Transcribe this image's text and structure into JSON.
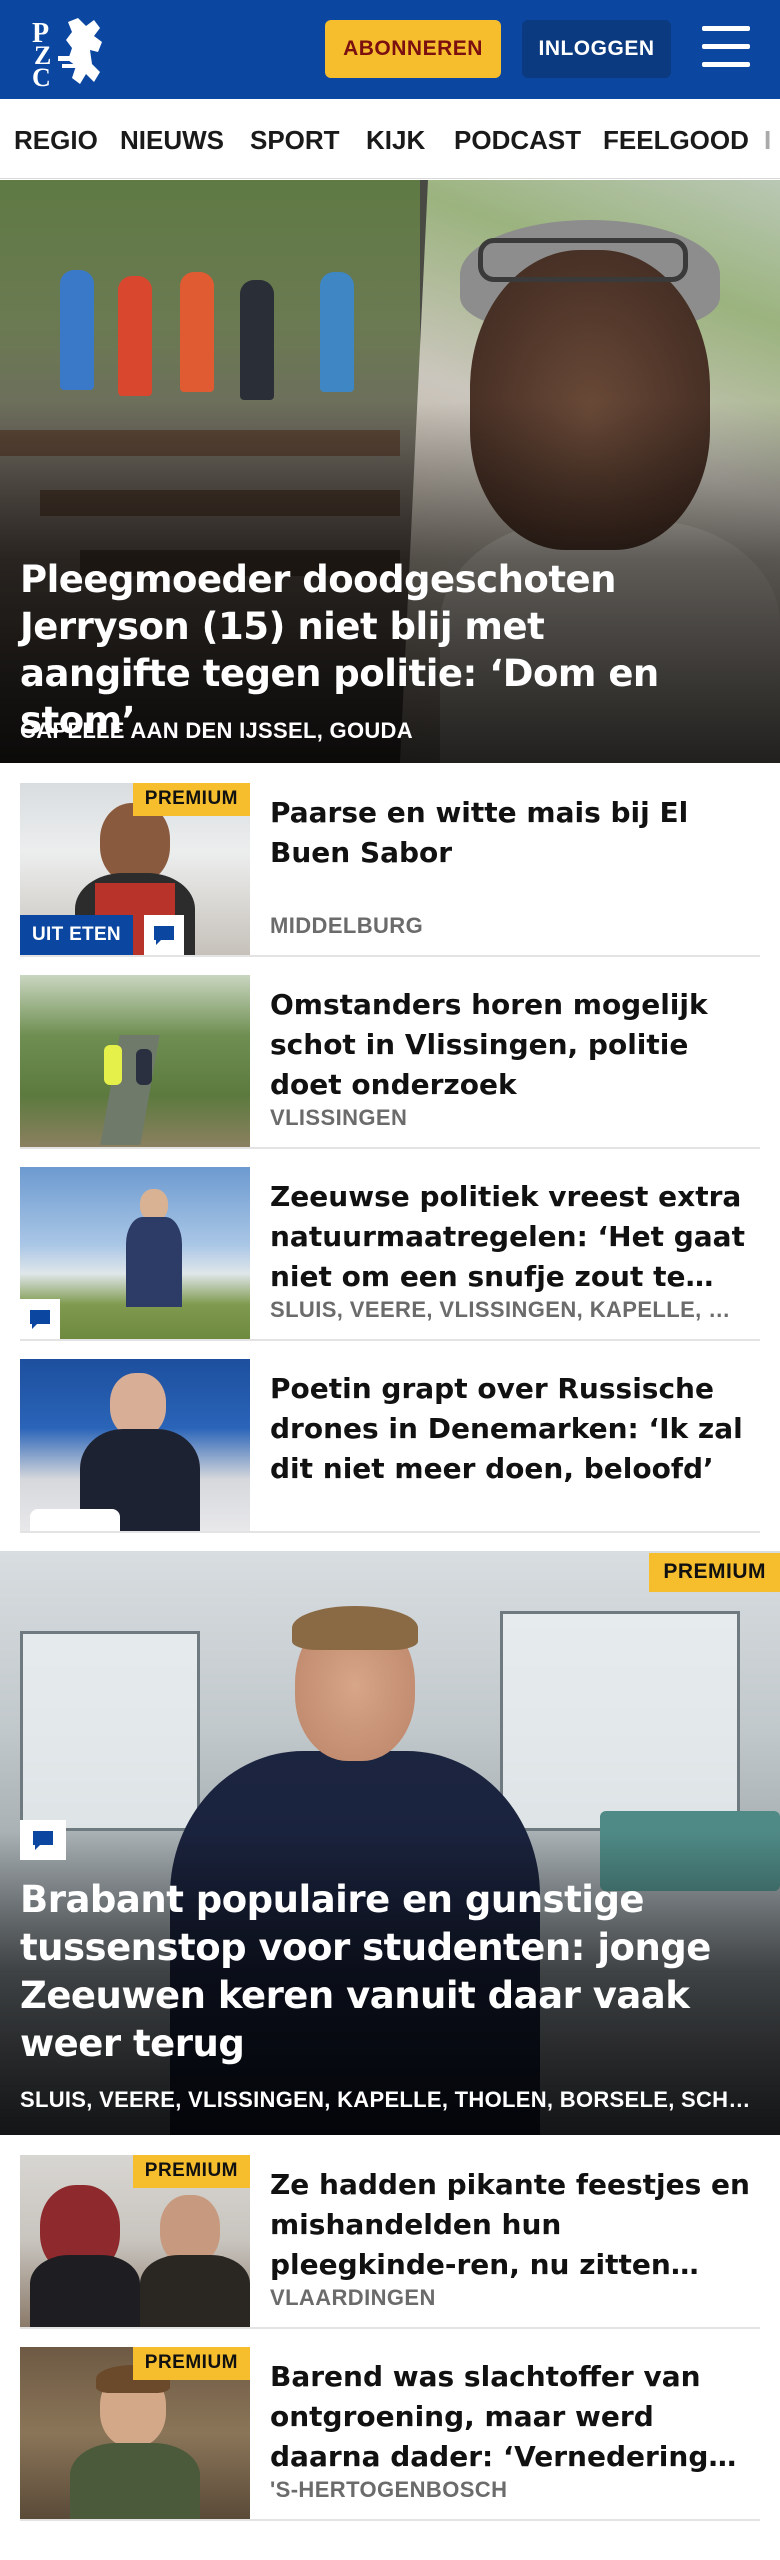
{
  "header": {
    "logo_text": "PZC",
    "subscribe_label": "ABONNEREN",
    "login_label": "INLOGGEN",
    "brand_color": "#0b47a1",
    "accent_color": "#f6be2c"
  },
  "nav": {
    "items": [
      {
        "label": "REGIO"
      },
      {
        "label": "NIEUWS"
      },
      {
        "label": "SPORT"
      },
      {
        "label": "KIJK"
      },
      {
        "label": "PODCAST"
      },
      {
        "label": "FEELGOOD"
      }
    ]
  },
  "hero": {
    "title": "Pleegmoeder doodgeschoten Jerryson (15) niet blij met aangifte tegen politie: ‘Dom en stom’",
    "location": "CAPELLE AAN DEN IJSSEL, GOUDA"
  },
  "articles": [
    {
      "title": "Paarse en witte mais bij El Buen Sabor",
      "location": "MIDDELBURG",
      "premium": "PREMIUM",
      "category": "UIT ETEN",
      "has_comments": true
    },
    {
      "title": "Omstanders horen mogelijk schot in Vlissingen, politie doet onderzoek",
      "location": "VLISSINGEN"
    },
    {
      "title": "Zeeuwse politiek vreest extra natuurmaatregelen: ‘Het gaat niet om een snufje zout te veel, maar om je voortbestaan’",
      "location": "SLUIS, VEERE, VLISSINGEN, KAPELLE, THOLEN",
      "has_comments": true
    },
    {
      "title": "Poetin grapt over Russische drones in Denemarken: ‘Ik zal dit niet meer doen, beloofd’",
      "location": ""
    }
  ],
  "feature": {
    "premium": "PREMIUM",
    "title": "Brabant populaire en gunstige tussenstop voor studenten: jonge Zeeuwen keren vanuit daar vaak weer terug",
    "location": "SLUIS, VEERE, VLISSINGEN, KAPELLE, THOLEN, BORSELE, SCHOUWEN-DUIVELAND",
    "has_comments": true
  },
  "articles_bottom": [
    {
      "title": "Ze hadden pikante feestjes en mishandelden hun pleegkinde-ren, nu zitten John en Daisy stil in de cel",
      "location": "VLAARDINGEN",
      "premium": "PREMIUM"
    },
    {
      "title": "Barend was slachtoffer van ontgroening, maar werd daarna dader: ‘Vernedering werkt verslavend’",
      "location": "'S-HERTOGENBOSCH",
      "premium": "PREMIUM"
    }
  ]
}
